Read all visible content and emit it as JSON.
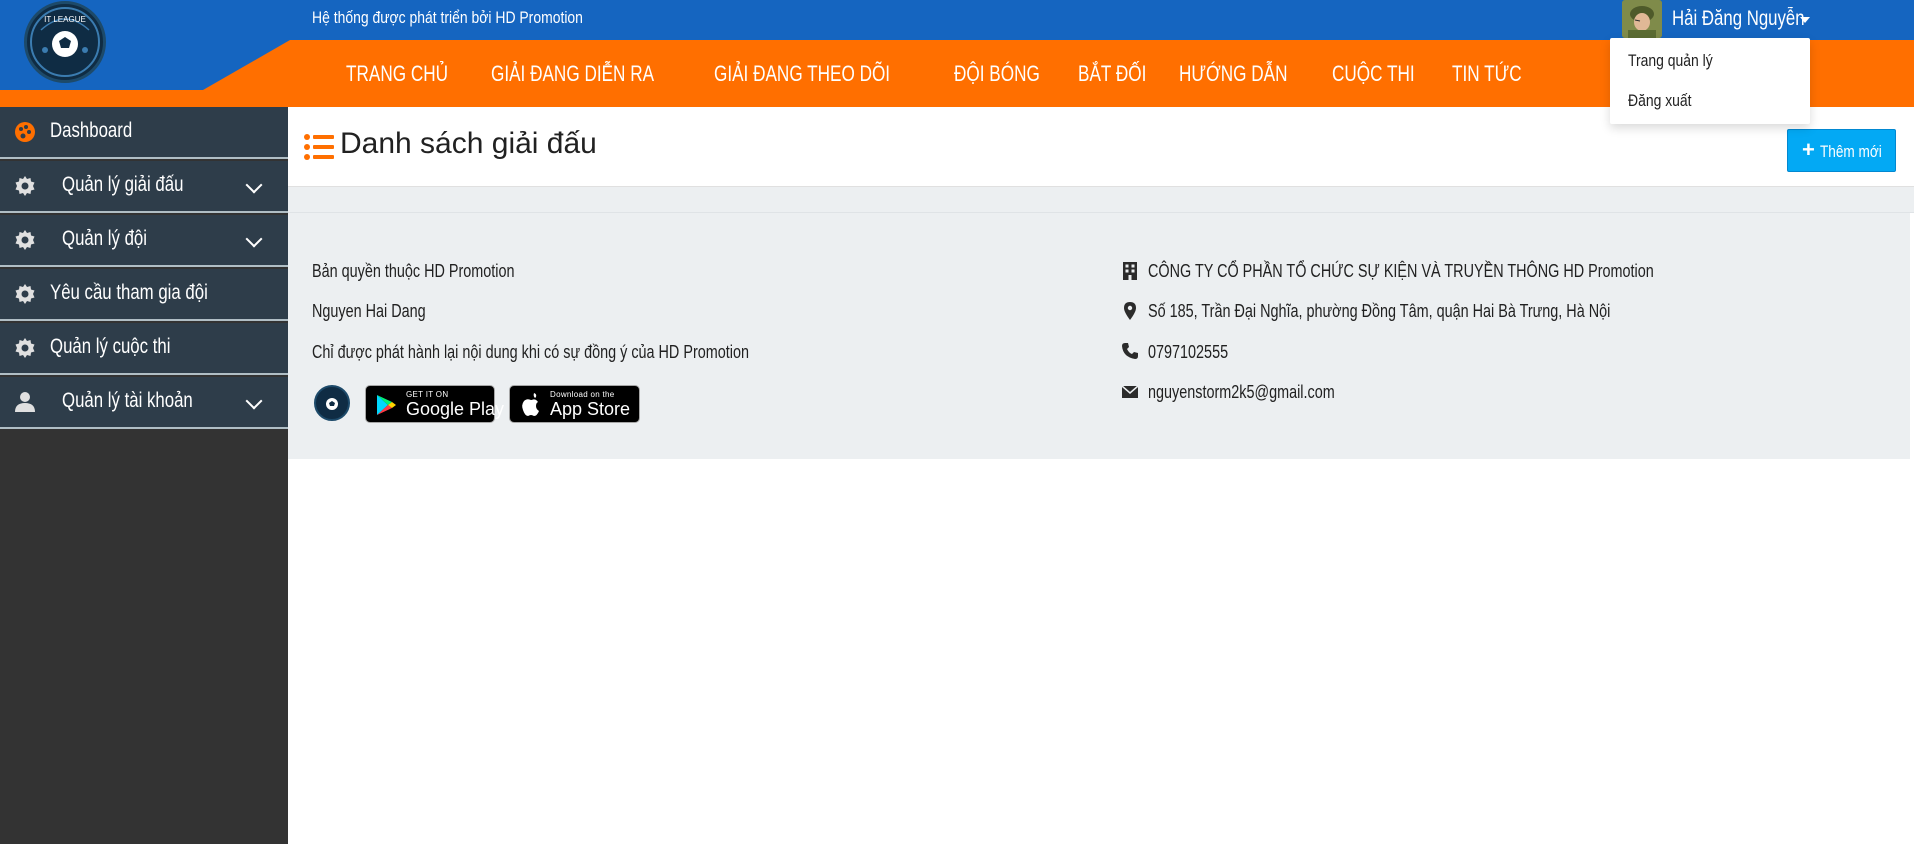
{
  "header": {
    "developer_text": "Hệ thống được phát triển bởi HD Promotion",
    "logo_text": "IT LEAGUE",
    "user_name": "Hải Đăng Nguyễn"
  },
  "nav": {
    "items": [
      {
        "label": "TRANG CHỦ"
      },
      {
        "label": "GIẢI ĐANG DIỄN RA"
      },
      {
        "label": "GIẢI ĐANG THEO DÕI"
      },
      {
        "label": "ĐỘI BÓNG"
      },
      {
        "label": "BẮT ĐỐI"
      },
      {
        "label": "HƯỚNG DẪN"
      },
      {
        "label": "CUỘC THI"
      },
      {
        "label": "TIN TỨC"
      }
    ]
  },
  "user_menu": {
    "items": [
      {
        "label": "Trang quản lý"
      },
      {
        "label": "Đăng xuất"
      }
    ]
  },
  "sidebar": {
    "items": [
      {
        "label": "Dashboard",
        "icon": "palette-icon",
        "expandable": false
      },
      {
        "label": "Quản lý giải đấu",
        "icon": "gear-icon",
        "expandable": true
      },
      {
        "label": "Quản lý đội",
        "icon": "gear-icon",
        "expandable": true
      },
      {
        "label": "Yêu cầu tham gia đội",
        "icon": "gear-icon",
        "expandable": false
      },
      {
        "label": "Quản lý cuộc thi",
        "icon": "gear-icon",
        "expandable": false
      },
      {
        "label": "Quản lý tài khoản",
        "icon": "user-icon",
        "expandable": true
      }
    ]
  },
  "main": {
    "title": "Danh sách giải đấu",
    "add_button": "Thêm mới"
  },
  "footer": {
    "copyright": "Bản quyền thuộc HD Promotion",
    "author": "Nguyen Hai Dang",
    "notice": "Chỉ được phát hành lại nội dung khi có sự đồng ý của HD Promotion",
    "company": "CÔNG TY CỔ PHẦN TỔ CHỨC SỰ KIỆN VÀ TRUYỀN THÔNG HD Promotion",
    "address": "Số 185, Trần Đại Nghĩa, phường Đồng Tâm, quận Hai Bà Trưng, Hà Nội",
    "phone": "0797102555",
    "email": "nguyenstorm2k5@gmail.com",
    "google_play": {
      "small": "GET IT ON",
      "big": "Google Play"
    },
    "app_store": {
      "small": "Download on the",
      "big": "App Store"
    }
  },
  "colors": {
    "primary_blue": "#1565c0",
    "nav_orange": "#ff6f00",
    "sidebar_dark": "#2e3d4a",
    "button_blue": "#03a9f4",
    "accent_orange": "#ff6f00"
  }
}
